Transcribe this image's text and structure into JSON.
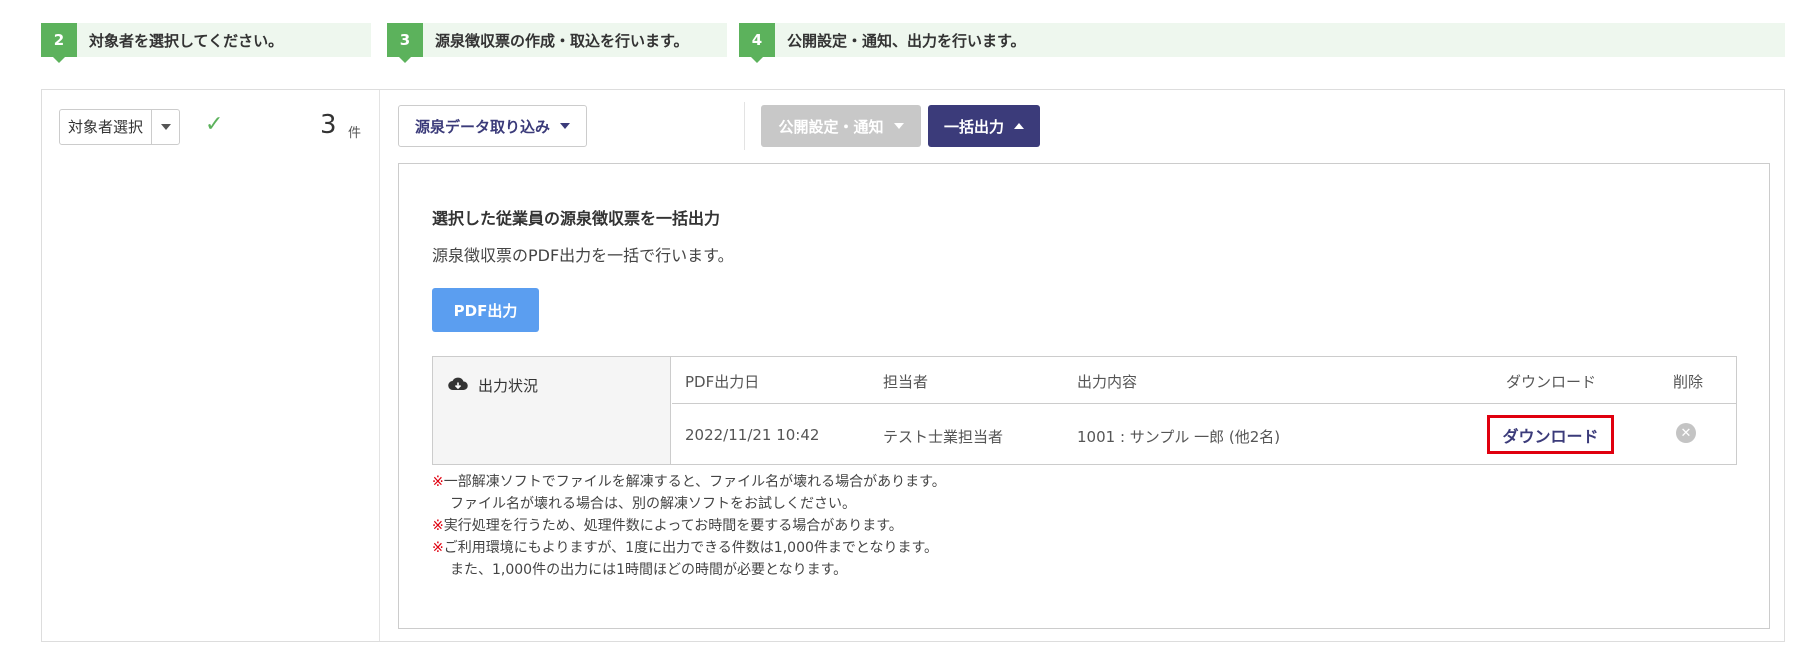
{
  "steps": [
    {
      "num": "2",
      "label": "対象者を選択してください。"
    },
    {
      "num": "3",
      "label": "源泉徴収票の作成・取込を行います。"
    },
    {
      "num": "4",
      "label": "公開設定・通知、出力を行います。"
    }
  ],
  "left": {
    "select_label": "対象者選択",
    "count": "3",
    "count_unit": "件"
  },
  "toolbar": {
    "import_label": "源泉データ取り込み",
    "publish_label": "公開設定・通知",
    "bulk_label": "一括出力"
  },
  "panel": {
    "title": "選択した従業員の源泉徴収票を一括出力",
    "desc": "源泉徴収票のPDF出力を一括で行います。",
    "pdf_button": "PDF出力",
    "status_label": "出力状況",
    "columns": [
      "PDF出力日",
      "担当者",
      "出力内容",
      "ダウンロード",
      "削除"
    ],
    "rows": [
      {
        "date": "2022/11/21 10:42",
        "person": "テスト士業担当者",
        "content": "1001 : サンプル 一郎 (他2名)",
        "download": "ダウンロード"
      }
    ],
    "notes": [
      {
        "mark": "※",
        "text": "一部解凍ソフトでファイルを解凍すると、ファイル名が壊れる場合があります。"
      },
      {
        "mark": "",
        "text": "ファイル名が壊れる場合は、別の解凍ソフトをお試しください。"
      },
      {
        "mark": "※",
        "text": "実行処理を行うため、処理件数によってお時間を要する場合があります。"
      },
      {
        "mark": "※",
        "text": "ご利用環境にもよりますが、1度に出力できる件数は1,000件までとなります。"
      },
      {
        "mark": "",
        "text": "また、1,000件の出力には1時間ほどの時間が必要となります。"
      }
    ]
  },
  "colors": {
    "step_green": "#5cb25c",
    "navy": "#3b3b7a",
    "pdf_blue": "#5b9ef0",
    "highlight_red": "#e0000f"
  }
}
